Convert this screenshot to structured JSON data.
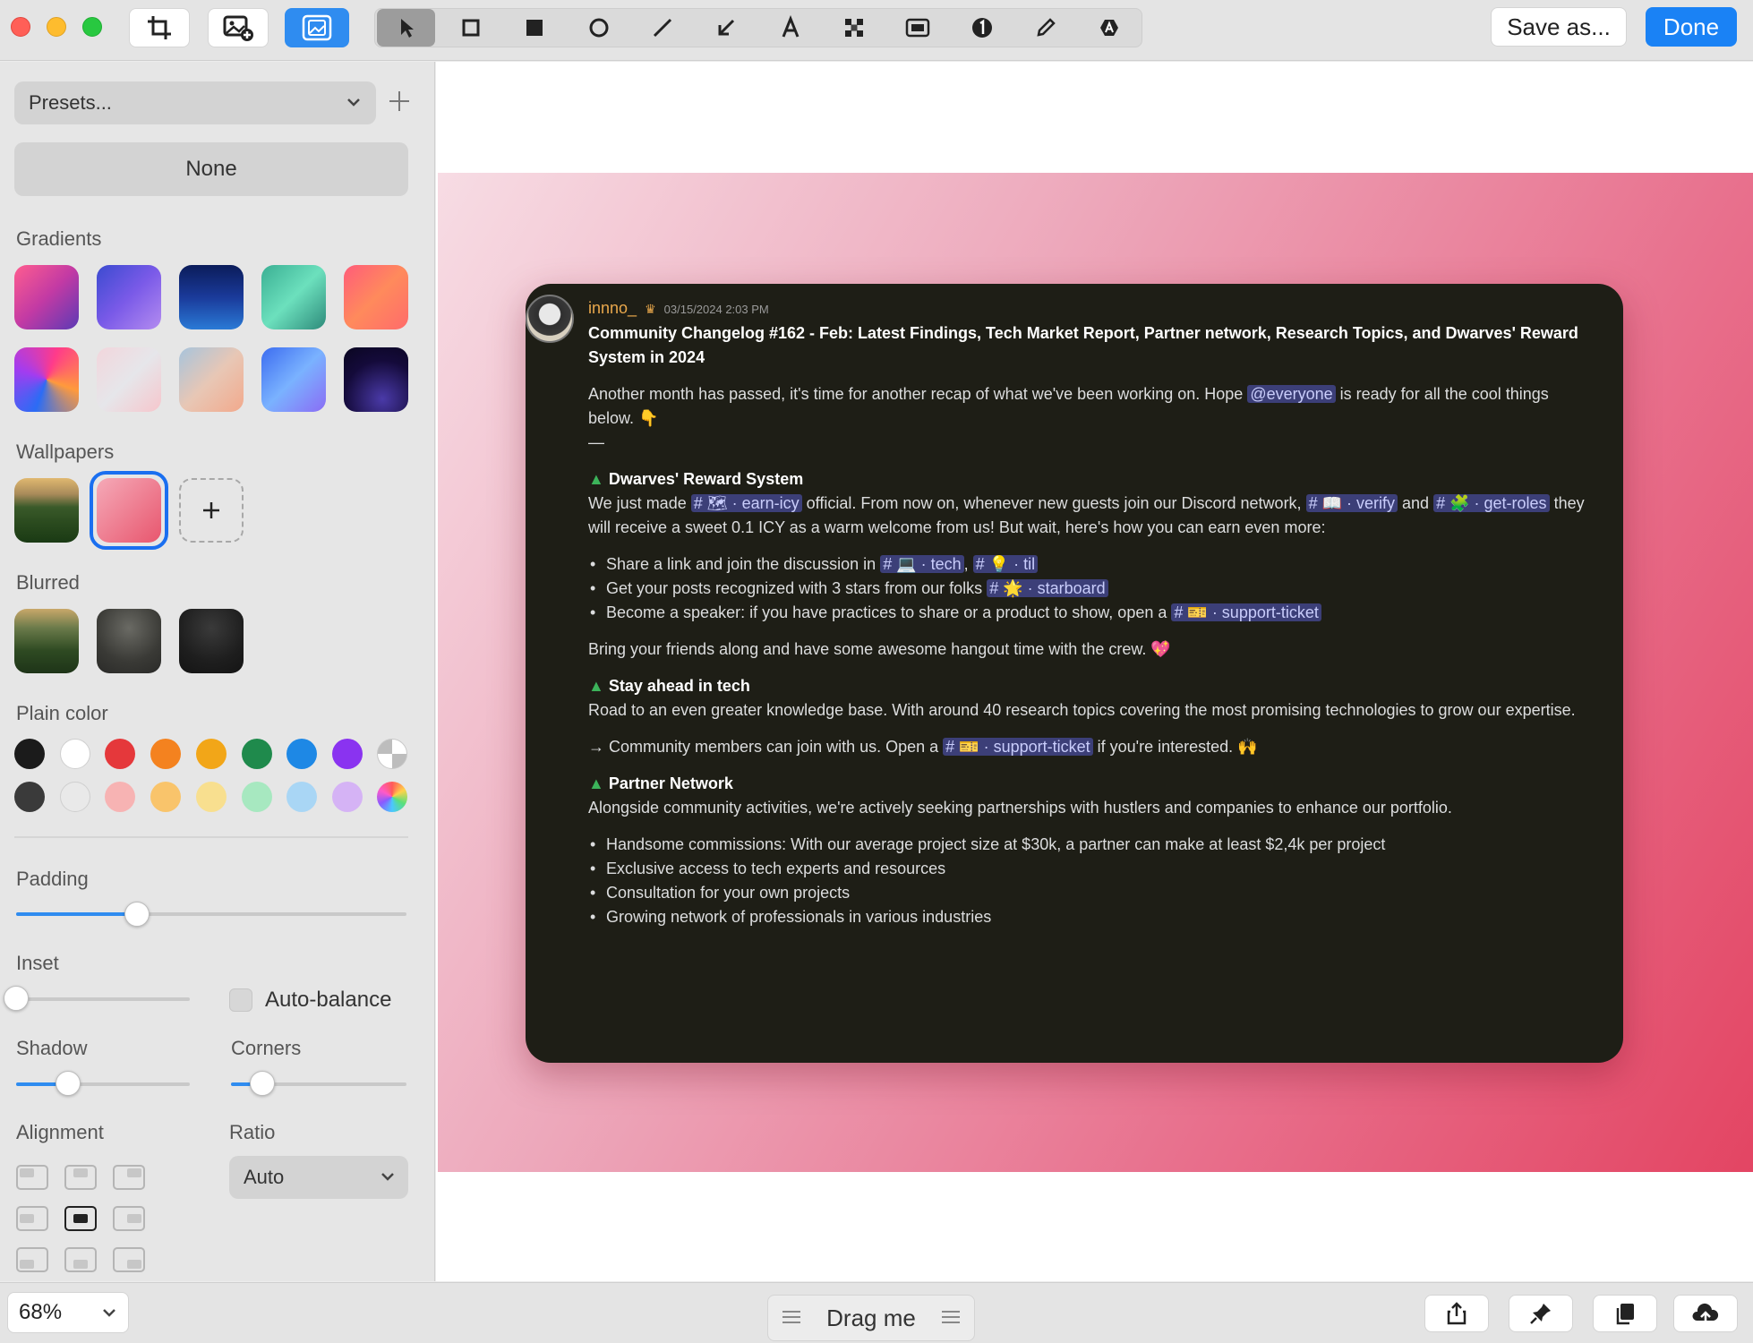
{
  "toolbar": {
    "save_label": "Save as...",
    "done_label": "Done",
    "tools": [
      "select-arrow-icon",
      "rectangle-outline-icon",
      "rectangle-filled-icon",
      "ellipse-icon",
      "line-icon",
      "arrow-icon",
      "text-icon",
      "pixelate-icon",
      "highlight-box-icon",
      "counter-icon",
      "pencil-icon",
      "text-rotate-icon"
    ]
  },
  "sidebar": {
    "presets_label": "Presets...",
    "none_label": "None",
    "gradients_label": "Gradients",
    "wallpapers_label": "Wallpapers",
    "blurred_label": "Blurred",
    "plain_color_label": "Plain color",
    "padding_label": "Padding",
    "padding_value": 0.31,
    "inset_label": "Inset",
    "inset_value": 0.0,
    "auto_balance_label": "Auto-balance",
    "shadow_label": "Shadow",
    "shadow_value": 0.3,
    "corners_label": "Corners",
    "corners_value": 0.18,
    "alignment_label": "Alignment",
    "ratio_label": "Ratio",
    "ratio_value": "Auto",
    "plain_colors_row1": [
      "#1b1b1b",
      "#ffffff",
      "#e5383b",
      "#f4821f",
      "#f2a618",
      "#1f8a4c",
      "#1e88e5",
      "#8a33f0"
    ],
    "plain_colors_row2": [
      "#3a3a3a",
      "#e9e9e9",
      "#f7b3b3",
      "#f9c46b",
      "#f8df8f",
      "#a7e8c0",
      "#a9d6f5",
      "#d5b3f5"
    ]
  },
  "message": {
    "username": "innno_",
    "timestamp": "03/15/2024 2:03 PM",
    "title": "Community Changelog #162 - Feb: Latest Findings, Tech Market Report, Partner network, Research Topics, and Dwarves' Reward System in 2024",
    "intro_1": "Another month has passed, it's time for another recap of what we've been working on. Hope",
    "intro_mention": "@everyone",
    "intro_2": "is ready for all the cool things below.",
    "dash": "—",
    "s1_title": "Dwarves' Reward System",
    "s1_p1a": "We just made",
    "s1_ch1": "# 🗺 · earn-icy",
    "s1_p1b": "official. From now on, whenever new guests join our Discord network,",
    "s1_ch2": "# 📖 · verify",
    "s1_and": "and",
    "s1_ch3": "# 🧩 · get-roles",
    "s1_p1c": "they will receive a sweet 0.1 ICY as a warm welcome from us! But wait, here's how you can earn even more:",
    "b1": "Share a link and join the discussion in",
    "b1_ch1": "# 💻 · tech",
    "b1_ch2": "# 💡 · til",
    "b2": "Get your posts recognized with 3 stars from our folks",
    "b2_ch": "# 🌟 · starboard",
    "b3": "Become a speaker: if you have practices to share or a product to show, open a",
    "b3_ch": "# 🎫 · support-ticket",
    "bring": "Bring your friends along and have some awesome hangout time with the crew.",
    "s2_title": "Stay ahead in tech",
    "s2_p": "Road to an even greater knowledge base. With around 40 research topics covering the most promising technologies to grow our expertise.",
    "s2_join": "→ Community members can join with us. Open a",
    "s2_ch": "# 🎫 · support-ticket",
    "s2_join2": "if you're interested.",
    "s3_title": "Partner Network",
    "s3_p": "Alongside community activities, we're actively seeking partnerships with hustlers and companies to enhance our portfolio.",
    "s3_b1": "Handsome commissions: With our average project size at $30k, a partner can make at least $2,4k per project",
    "s3_b2": "Exclusive access to tech experts and resources",
    "s3_b3": "Consultation for your own projects",
    "s3_b4": "Growing network of professionals in various industries"
  },
  "bottom": {
    "zoom": "68%",
    "drag_label": "Drag me"
  }
}
